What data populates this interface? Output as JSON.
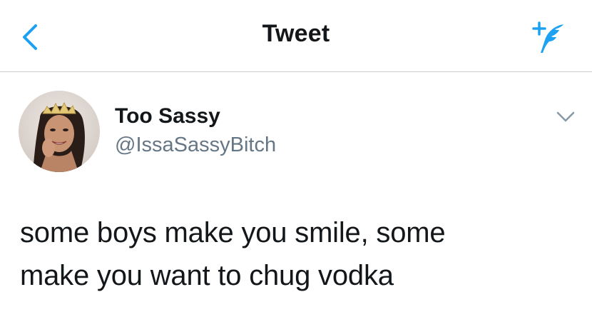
{
  "navbar": {
    "back_icon": "chevron-left-icon",
    "title": "Tweet",
    "compose_icon": "compose-tweet-icon"
  },
  "author": {
    "display_name": "Too Sassy",
    "handle": "@IssaSassyBitch",
    "avatar_icon": "profile-photo"
  },
  "tweet": {
    "line1": "some boys make you smile, some",
    "line2": "make you want to chug vodka"
  },
  "menu": {
    "icon": "chevron-down-icon"
  },
  "colors": {
    "accent": "#1da1f2",
    "text_primary": "#14171a",
    "text_secondary": "#657786",
    "divider": "#c8ccd0"
  }
}
